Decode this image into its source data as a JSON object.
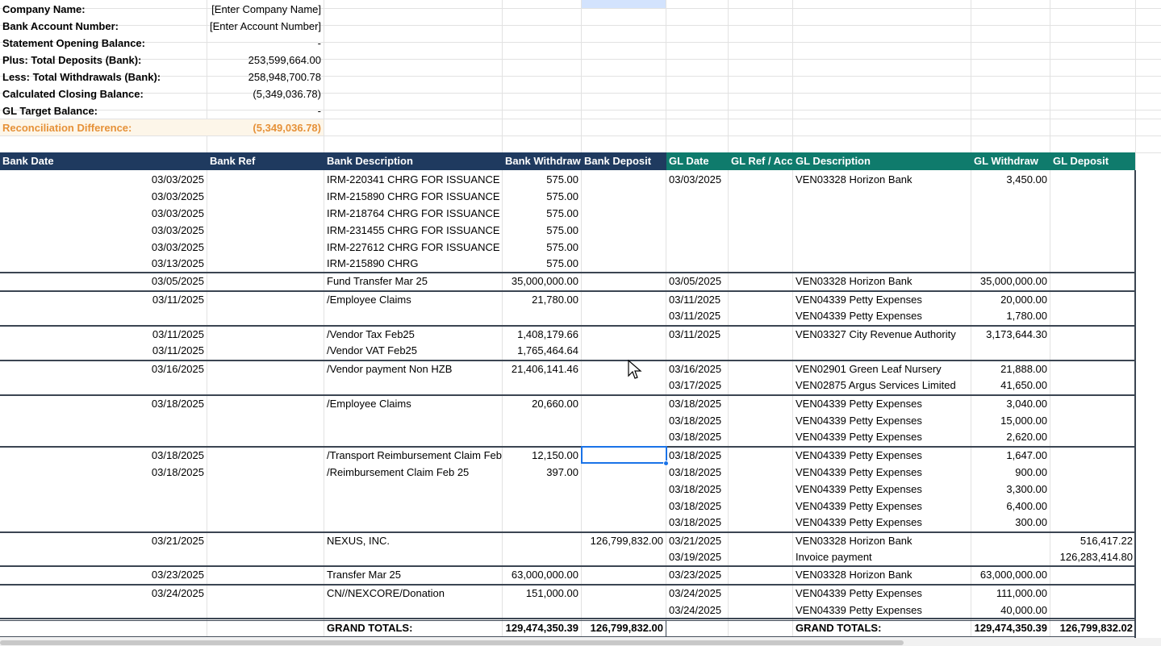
{
  "summary": [
    {
      "label": "Company Name:",
      "value": "[Enter Company Name]"
    },
    {
      "label": "Bank Account Number:",
      "value": "[Enter Account Number]"
    },
    {
      "label": "Statement Opening Balance:",
      "value": "-"
    },
    {
      "label": "Plus: Total Deposits (Bank):",
      "value": "253,599,664.00"
    },
    {
      "label": "Less: Total Withdrawals (Bank):",
      "value": "258,948,700.78"
    },
    {
      "label": "Calculated Closing Balance:",
      "value": "(5,349,036.78)"
    },
    {
      "label": "GL Target Balance:",
      "value": "-"
    },
    {
      "label": "Reconciliation Difference:",
      "value": "(5,349,036.78)"
    }
  ],
  "headers": [
    "Bank Date",
    "Bank Ref",
    "Bank Description",
    "Bank Withdraw",
    "Bank Deposit",
    "GL Date",
    "GL Ref / Acc",
    "GL Description",
    "GL Withdraw",
    "GL Deposit"
  ],
  "rows": [
    [
      "03/03/2025",
      "",
      "IRM-220341 CHRG FOR ISSUANCE",
      "575.00",
      "",
      "03/03/2025",
      "",
      "VEN03328 Horizon Bank",
      "3,450.00",
      ""
    ],
    [
      "03/03/2025",
      "",
      "IRM-215890 CHRG FOR ISSUANCE",
      "575.00",
      "",
      "",
      "",
      "",
      "",
      ""
    ],
    [
      "03/03/2025",
      "",
      "IRM-218764 CHRG FOR ISSUANCE",
      "575.00",
      "",
      "",
      "",
      "",
      "",
      ""
    ],
    [
      "03/03/2025",
      "",
      "IRM-231455 CHRG FOR ISSUANCE",
      "575.00",
      "",
      "",
      "",
      "",
      "",
      ""
    ],
    [
      "03/03/2025",
      "",
      "IRM-227612 CHRG FOR ISSUANCE",
      "575.00",
      "",
      "",
      "",
      "",
      "",
      ""
    ],
    [
      "03/13/2025",
      "",
      "IRM-215890 CHRG",
      "575.00",
      "",
      "",
      "",
      "",
      "",
      ""
    ],
    [
      "03/05/2025",
      "",
      " Fund Transfer Mar 25",
      "35,000,000.00",
      "",
      "03/05/2025",
      "",
      "VEN03328 Horizon Bank",
      "35,000,000.00",
      ""
    ],
    [
      "03/11/2025",
      "",
      "/Employee Claims",
      "21,780.00",
      "",
      "03/11/2025",
      "",
      "VEN04339 Petty Expenses",
      "20,000.00",
      ""
    ],
    [
      "",
      "",
      "",
      "",
      "",
      "03/11/2025",
      "",
      "VEN04339 Petty Expenses",
      "1,780.00",
      ""
    ],
    [
      "03/11/2025",
      "",
      "/Vendor Tax Feb25",
      "1,408,179.66",
      "",
      "03/11/2025",
      "",
      "VEN03327 City Revenue Authority",
      "3,173,644.30",
      ""
    ],
    [
      "03/11/2025",
      "",
      "/Vendor VAT Feb25",
      "1,765,464.64",
      "",
      "",
      "",
      "",
      "",
      ""
    ],
    [
      "03/16/2025",
      "",
      "/Vendor payment Non HZB",
      "21,406,141.46",
      "",
      "03/16/2025",
      "",
      "VEN02901 Green Leaf Nursery",
      "21,888.00",
      ""
    ],
    [
      "",
      "",
      "",
      "",
      "",
      "03/17/2025",
      "",
      "VEN02875 Argus Services Limited",
      "41,650.00",
      ""
    ],
    [
      "03/18/2025",
      "",
      "/Employee Claims",
      "20,660.00",
      "",
      "03/18/2025",
      "",
      "VEN04339 Petty Expenses",
      "3,040.00",
      ""
    ],
    [
      "",
      "",
      "",
      "",
      "",
      "03/18/2025",
      "",
      "VEN04339 Petty Expenses",
      "15,000.00",
      ""
    ],
    [
      "",
      "",
      "",
      "",
      "",
      "03/18/2025",
      "",
      "VEN04339 Petty Expenses",
      "2,620.00",
      ""
    ],
    [
      "03/18/2025",
      "",
      "/Transport Reimbursement Claim Feb",
      "12,150.00",
      "",
      "03/18/2025",
      "",
      "VEN04339 Petty Expenses",
      "1,647.00",
      ""
    ],
    [
      "03/18/2025",
      "",
      "/Reimbursement Claim Feb 25",
      "397.00",
      "",
      "03/18/2025",
      "",
      "VEN04339 Petty Expenses",
      "900.00",
      ""
    ],
    [
      "",
      "",
      "",
      "",
      "",
      "03/18/2025",
      "",
      "VEN04339 Petty Expenses",
      "3,300.00",
      ""
    ],
    [
      "",
      "",
      "",
      "",
      "",
      "03/18/2025",
      "",
      "VEN04339 Petty Expenses",
      "6,400.00",
      ""
    ],
    [
      "",
      "",
      "",
      "",
      "",
      "03/18/2025",
      "",
      "VEN04339 Petty Expenses",
      "300.00",
      ""
    ],
    [
      "03/21/2025",
      "",
      " NEXUS, INC.",
      "",
      "126,799,832.00",
      "03/21/2025",
      "",
      "VEN03328 Horizon Bank",
      "",
      "516,417.22"
    ],
    [
      "",
      "",
      "",
      "",
      "",
      "03/19/2025",
      "",
      "Invoice payment",
      "",
      "126,283,414.80"
    ],
    [
      "03/23/2025",
      "",
      " Transfer Mar 25",
      "63,000,000.00",
      "",
      "03/23/2025",
      "",
      "VEN03328 Horizon Bank",
      "63,000,000.00",
      ""
    ],
    [
      "03/24/2025",
      "",
      "CN//NEXCORE/Donation",
      "151,000.00",
      "",
      "03/24/2025",
      "",
      "VEN04339 Petty Expenses",
      "111,000.00",
      ""
    ],
    [
      "",
      "",
      "",
      "",
      "",
      "03/24/2025",
      "",
      "VEN04339 Petty Expenses",
      "40,000.00",
      ""
    ]
  ],
  "totals": [
    "",
    "",
    "GRAND TOTALS:",
    "129,474,350.39",
    "126,799,832.00",
    "",
    "",
    "GRAND TOTALS:",
    "129,474,350.39",
    "126,799,832.02"
  ],
  "colors": {
    "bank_header": "#1f3a5f",
    "gl_header": "#0f7b6c",
    "diff_text": "#e69138",
    "diff_bg": "#fdf6e9",
    "selection": "#1a73e8"
  }
}
